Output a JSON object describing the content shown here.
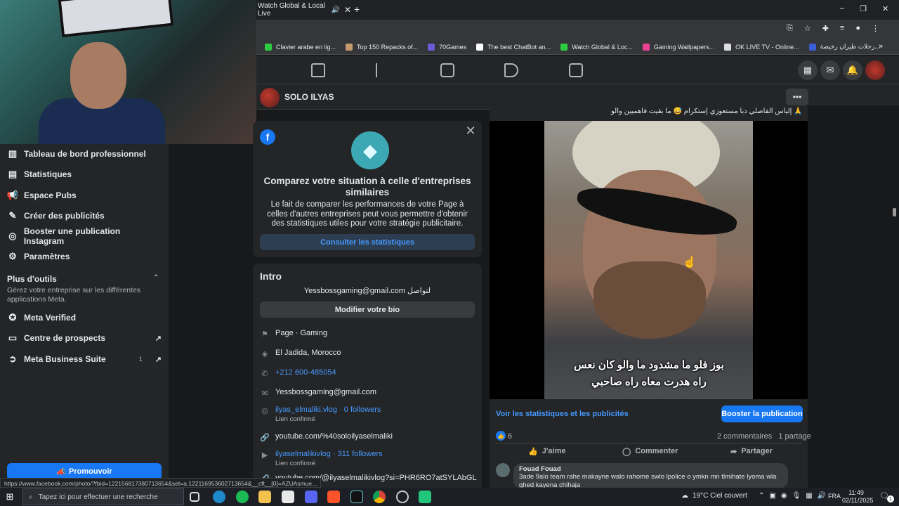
{
  "browser": {
    "tab_title": "Watch Global & Local Live",
    "bookmarks": [
      {
        "label": "Clavier arabe en lig...",
        "color": "#2ecc40"
      },
      {
        "label": "Top 150 Repacks of...",
        "color": "#c49a6c"
      },
      {
        "label": "70Games",
        "color": "#6b5bd6"
      },
      {
        "label": "The best ChatBot an...",
        "color": "#ffffff"
      },
      {
        "label": "Watch Global & Loc...",
        "color": "#2ecc40"
      },
      {
        "label": "Gaming Wallpapers...",
        "color": "#e84393"
      },
      {
        "label": "OK LIVE TV - Online...",
        "color": "#dddddd"
      },
      {
        "label": "رحلات طيران رخيصة...",
        "color": "#3b5ed6"
      }
    ],
    "status_url": "https://www.facebook.com/photo/?fbid=122156817380713654&set=a.122116953602713654&__cft__[0]=AZUAsmue..."
  },
  "page": {
    "name": "SOLO ILYAS"
  },
  "sidebar": {
    "items": [
      {
        "label": "Tableau de bord professionnel",
        "icon": "dashboard-icon"
      },
      {
        "label": "Statistiques",
        "icon": "stats-icon"
      },
      {
        "label": "Espace Pubs",
        "icon": "megaphone-icon"
      },
      {
        "label": "Créer des publicités",
        "icon": "edit-icon"
      },
      {
        "label": "Booster une publication Instagram",
        "icon": "instagram-icon"
      },
      {
        "label": "Paramètres",
        "icon": "gear-icon"
      }
    ],
    "more_tools_title": "Plus d'outils",
    "more_tools_desc": "Gérez votre entreprise sur les différentes applications Meta.",
    "tools": [
      {
        "label": "Meta Verified",
        "icon": "verified-icon",
        "badge": ""
      },
      {
        "label": "Centre de prospects",
        "icon": "prospects-icon",
        "badge": ""
      },
      {
        "label": "Meta Business Suite",
        "icon": "business-suite-icon",
        "badge": "1"
      }
    ],
    "promote_label": "Promouvoir"
  },
  "compare_card": {
    "title": "Comparez votre situation à celle d'entreprises similaires",
    "body": "Le fait de comparer les performances de votre Page à celles d'autres entreprises peut vous permettre d'obtenir des statistiques utiles pour votre stratégie publicitaire.",
    "button": "Consulter les statistiques"
  },
  "intro": {
    "title": "Intro",
    "bio": "Yessbossgaming@gmail.com لتواصل",
    "edit_bio": "Modifier votre bio",
    "category": "Page · Gaming",
    "location": "El Jadida, Morocco",
    "phone": "+212 600-485054",
    "email": "Yessbossgaming@gmail.com",
    "instagram1": "ilyas_elmaliki.vlog · 0 followers",
    "instagram1_sub": "Lien confirmé",
    "website1": "youtube.com/%40soloilyaselmaliki",
    "instagram2": "ilyaselmalikivlog · 311 followers",
    "instagram2_sub": "Lien confirmé",
    "website2": "youtube.com/@ilyaselmalikivlog?si=PHR6RO7atSYLAbGL"
  },
  "post": {
    "header_text": "إلياس الفاصلي دبا مستعوزي إستكرام 😅 ما بقيت فاهميين والو 🙏",
    "subtitle_line1": "بوز فلو ما مشدود ما والو كان نعس",
    "subtitle_line2": "راه هدرت معاه راه صاحبي",
    "stats_link": "Voir les statistiques et les publicités",
    "boost_button": "Booster la publication",
    "like_count": "6",
    "comments_count": "2 commentaires",
    "shares_count": "1 partage",
    "actions": {
      "like": "J'aime",
      "comment": "Commenter",
      "share": "Partager"
    },
    "comment": {
      "author": "Fouad Fouad",
      "text": "3ade 9alo team rahe makayne walo rahome swlo lpolice o ymkn mn tlmihate lyoma wla ghed kayena chihaja"
    }
  },
  "taskbar": {
    "search_placeholder": "Tapez ici pour effectuer une recherche",
    "weather": "19°C Ciel couvert",
    "lang": "FRA",
    "time": "11:49",
    "date": "02/11/2025",
    "notif_count": "1"
  },
  "colors": {
    "fb_blue": "#1877f2",
    "link_blue": "#4599ff",
    "card_bg": "#242526",
    "page_bg": "#18191a"
  }
}
